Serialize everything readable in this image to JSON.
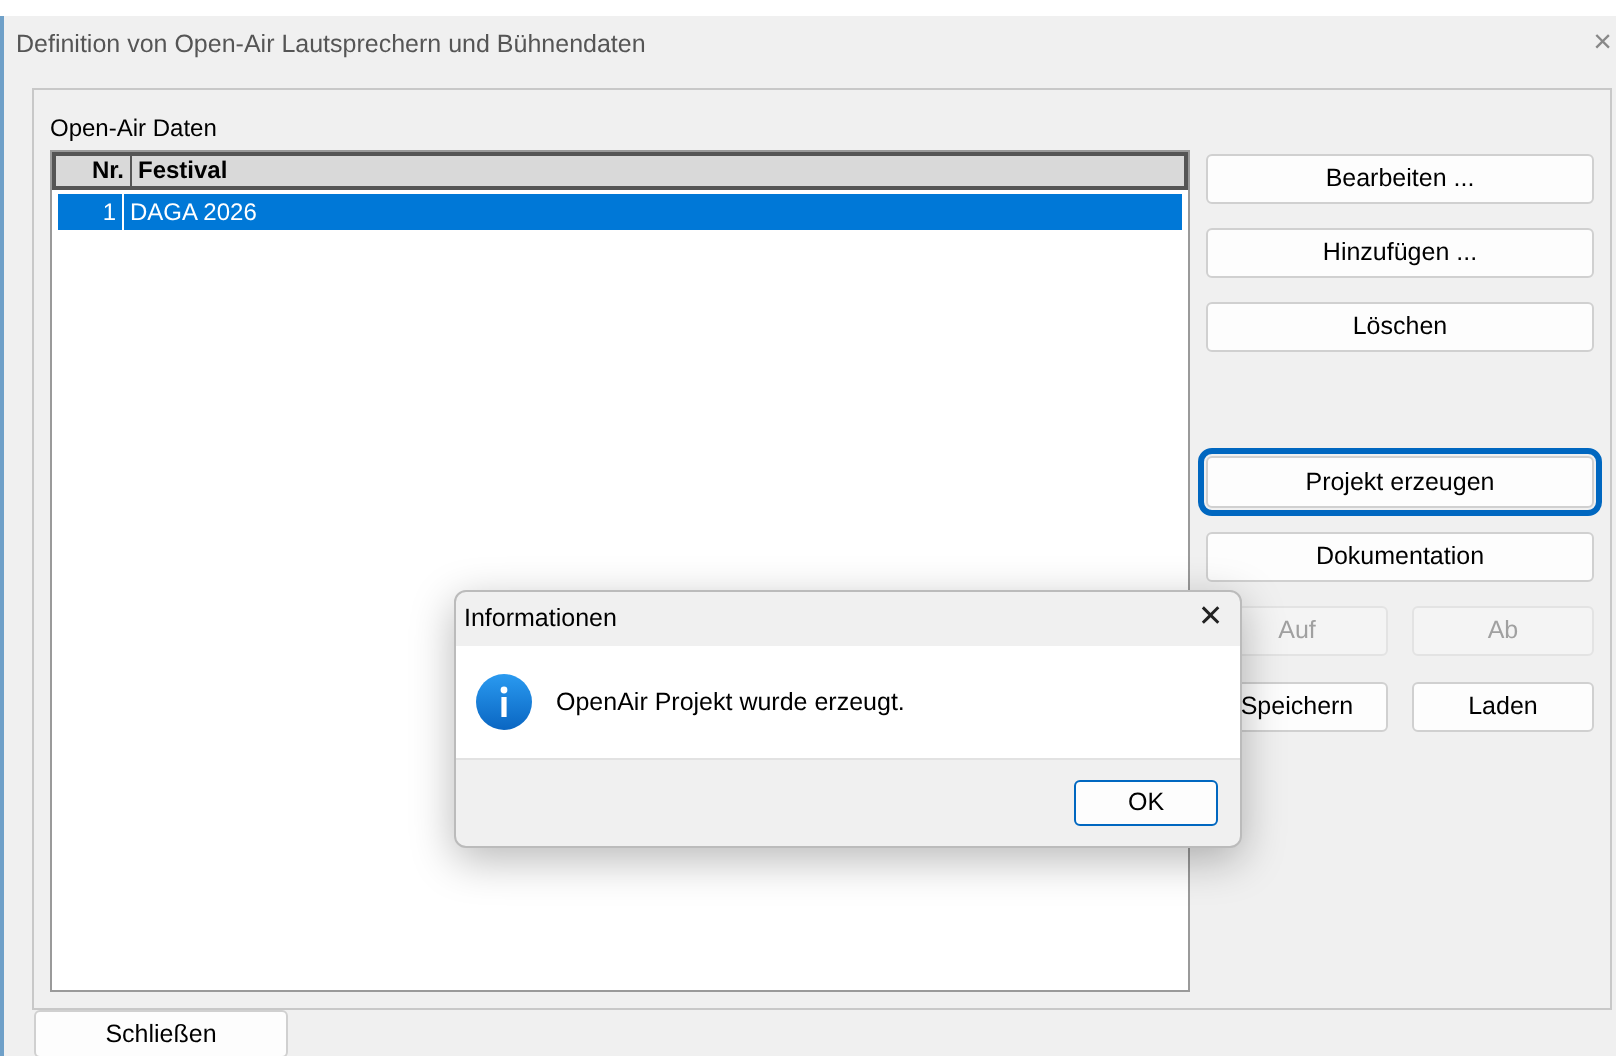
{
  "window": {
    "title": "Definition von Open-Air Lautsprechern und Bühnendaten",
    "close": "×"
  },
  "group": {
    "label": "Open-Air Daten"
  },
  "table": {
    "columns": [
      "Nr.",
      "Festival"
    ],
    "rows": [
      {
        "cells": [
          "1",
          "DAGA 2026"
        ],
        "selected": true
      }
    ]
  },
  "buttons": [
    {
      "label": "Bearbeiten ...",
      "kind": "wide",
      "disabled": false,
      "focused": false
    },
    {
      "label": "Hinzufügen ...",
      "kind": "wide",
      "disabled": false,
      "focused": false
    },
    {
      "label": "Löschen",
      "kind": "wide",
      "disabled": false,
      "focused": false
    },
    {
      "label": "Projekt erzeugen",
      "kind": "wide",
      "disabled": false,
      "focused": true
    },
    {
      "label": "Dokumentation",
      "kind": "wide",
      "disabled": false,
      "focused": false
    },
    {
      "label": "Auf",
      "kind": "half",
      "disabled": true,
      "focused": false
    },
    {
      "label": "Ab",
      "kind": "half",
      "disabled": true,
      "focused": false
    },
    {
      "label": "Speichern",
      "kind": "half",
      "disabled": false,
      "focused": false
    },
    {
      "label": "Laden",
      "kind": "half",
      "disabled": false,
      "focused": false
    }
  ],
  "close_button": {
    "label": "Schließen"
  },
  "dialog": {
    "title": "Informationen",
    "close": "✕",
    "message": "OpenAir Projekt wurde erzeugt.",
    "button": "OK"
  }
}
